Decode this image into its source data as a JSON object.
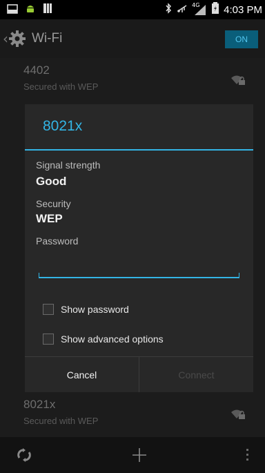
{
  "status_bar": {
    "time": "4:03 PM",
    "network_label": "4G"
  },
  "action_bar": {
    "back_glyph": "‹",
    "title": "Wi-Fi",
    "toggle_label": "ON"
  },
  "networks": [
    {
      "name": "4402",
      "status": "Secured with WEP"
    },
    {
      "name": "8021x",
      "status": "Secured with WEP"
    }
  ],
  "dialog": {
    "title": "8021x",
    "signal_label": "Signal strength",
    "signal_value": "Good",
    "security_label": "Security",
    "security_value": "WEP",
    "password_label": "Password",
    "password_value": "",
    "show_password_label": "Show password",
    "show_advanced_label": "Show advanced options",
    "cancel_label": "Cancel",
    "connect_label": "Connect"
  },
  "colors": {
    "accent": "#33b5e5",
    "background": "#1c1c1c",
    "dialog_background": "#282828"
  },
  "icons": {
    "status_left": [
      "screenshot-icon",
      "android-icon",
      "notification-icon"
    ],
    "status_right": [
      "bluetooth-icon",
      "usb-icon",
      "signal-icon",
      "battery-icon"
    ],
    "action_bar": "settings-gear-icon",
    "network_rows": "wifi-lock-icon",
    "bottom_bar": [
      "wps-icon",
      "add-network-icon",
      "overflow-menu-icon"
    ]
  }
}
